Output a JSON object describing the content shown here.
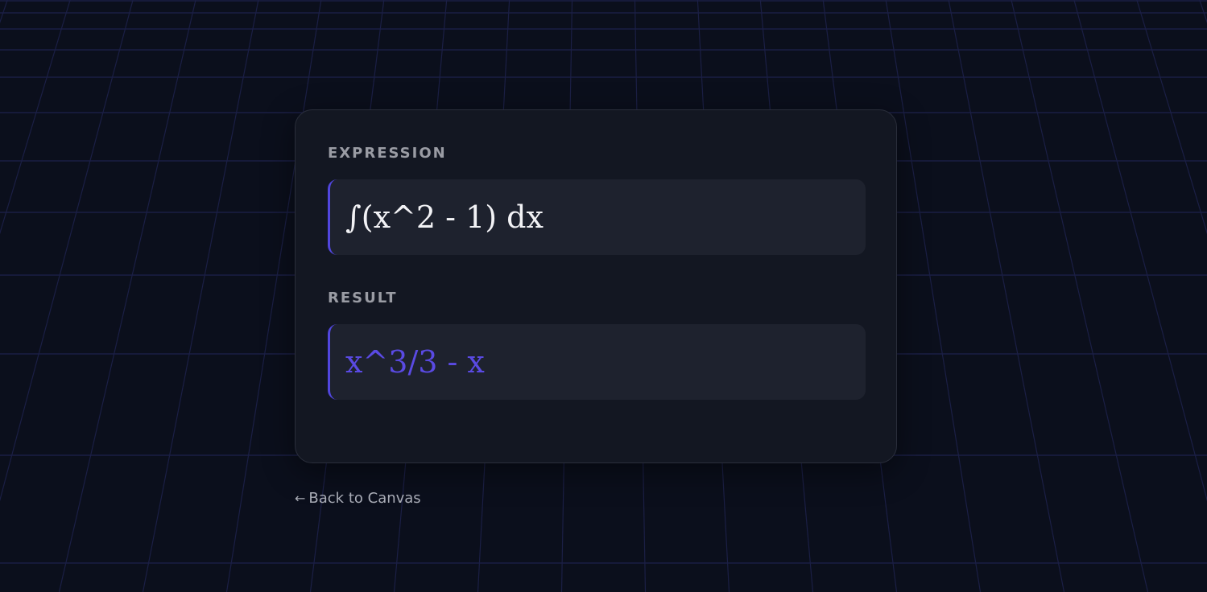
{
  "expression_section": {
    "label": "EXPRESSION",
    "value": "∫(x^2 - 1) dx"
  },
  "result_section": {
    "label": "RESULT",
    "value": "x^3/3 - x"
  },
  "navigation": {
    "back_arrow_icon": "arrow-left-icon",
    "back_arrow_glyph": "←",
    "back_label": "Back to Canvas"
  },
  "colors": {
    "background": "#0b0f1c",
    "grid_line": "#1b1f45",
    "card": "#131722",
    "field": "#1e222e",
    "accent": "#5146de",
    "result_text": "#5a4ae3",
    "label_text": "#9a9ca4"
  }
}
